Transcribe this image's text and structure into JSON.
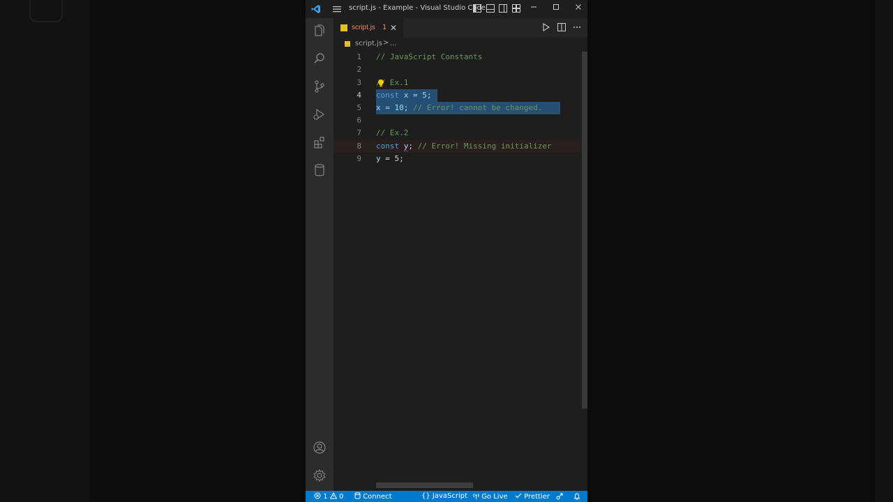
{
  "window": {
    "title": "script.js - Example - Visual Studio Code"
  },
  "tab": {
    "label": "script.js",
    "problem_count": "1",
    "close": "✕"
  },
  "breadcrumb": {
    "file": "script.js",
    "separator": ">",
    "more": "..."
  },
  "editor": {
    "lines": [
      {
        "number": "1",
        "text": "// JavaScript Constants"
      },
      {
        "number": "2",
        "text": ""
      },
      {
        "number": "3",
        "text": "// Ex.1"
      },
      {
        "number": "4",
        "keyword": "const",
        "rest": " x = 5;"
      },
      {
        "number": "5",
        "code": "x = 10; ",
        "comment": "// Error! cannot be changed."
      },
      {
        "number": "6",
        "text": ""
      },
      {
        "number": "7",
        "text": "// Ex.2"
      },
      {
        "number": "8",
        "keyword": "const",
        "var": "y",
        "semi": ";",
        "comment": " // Error! Missing initializer"
      },
      {
        "number": "9",
        "var": "y",
        "rest": " = 5;"
      }
    ]
  },
  "statusbar": {
    "errors": "1",
    "warnings": "0",
    "connect": "Connect",
    "language": "JavaScript",
    "golive": "Go Live",
    "prettier": "Prettier"
  },
  "icons": {
    "activity": [
      "explorer-icon",
      "search-icon",
      "source-control-icon",
      "run-debug-icon",
      "extensions-icon",
      "database-icon",
      "account-icon",
      "settings-gear-icon"
    ]
  },
  "colors": {
    "accent": "#007acc",
    "tab_error": "#f48771",
    "selection": "#264f78",
    "comment": "#6a9955",
    "keyword": "#569cd6"
  }
}
